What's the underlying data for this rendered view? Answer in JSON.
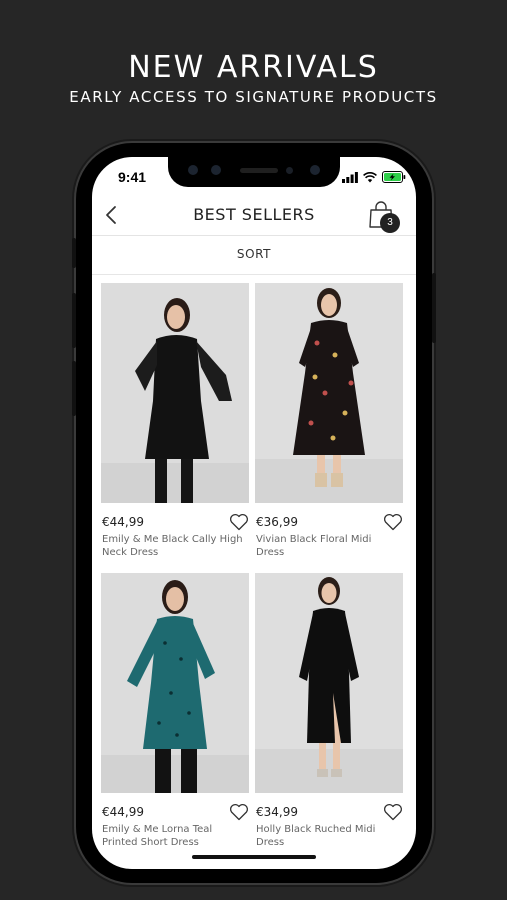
{
  "promo": {
    "title": "NEW ARRIVALS",
    "subtitle": "EARLY ACCESS TO SIGNATURE PRODUCTS"
  },
  "status_bar": {
    "time": "9:41"
  },
  "nav": {
    "title": "BEST SELLERS",
    "bag_count": "3"
  },
  "sort": {
    "label": "SORT"
  },
  "products": [
    {
      "price": "€44,99",
      "name": "Emily & Me Black Cally High Neck Dress",
      "dress_color": "#111111",
      "pattern": "solid"
    },
    {
      "price": "€36,99",
      "name": "Vivian Black Floral Midi Dress",
      "dress_color": "#1a1414",
      "pattern": "floral"
    },
    {
      "price": "€44,99",
      "name": "Emily & Me Lorna Teal Printed Short Dress",
      "dress_color": "#1e6a70",
      "pattern": "print"
    },
    {
      "price": "€34,99",
      "name": "Holly Black Ruched Midi Dress",
      "dress_color": "#0e0e0e",
      "pattern": "solid"
    }
  ],
  "colors": {
    "background": "#262626",
    "screen": "#ffffff",
    "text": "#222222"
  }
}
